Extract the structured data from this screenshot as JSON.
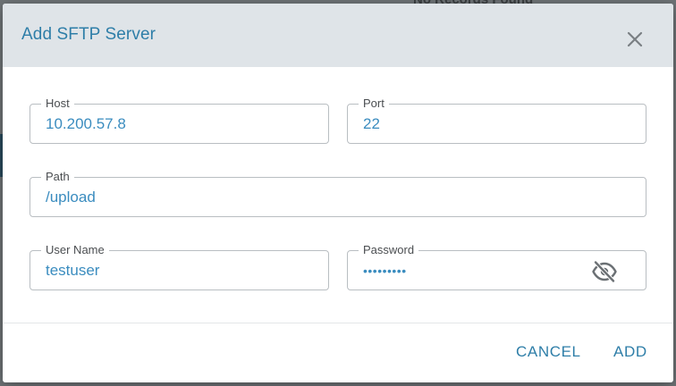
{
  "backdrop": {
    "partial_text": "No Records Found"
  },
  "dialog": {
    "title": "Add SFTP Server",
    "close_icon": "close-icon",
    "fields": {
      "host": {
        "label": "Host",
        "value": "10.200.57.8"
      },
      "port": {
        "label": "Port",
        "value": "22"
      },
      "path": {
        "label": "Path",
        "value": "/upload"
      },
      "username": {
        "label": "User Name",
        "value": "testuser"
      },
      "password": {
        "label": "Password",
        "value": "•••••••••",
        "toggle_icon": "eye-off-icon"
      }
    },
    "actions": {
      "cancel_label": "CANCEL",
      "add_label": "ADD"
    }
  },
  "colors": {
    "accent": "#2e7ea8",
    "value_text": "#3a8cbf",
    "header_bg": "#dfe4e8",
    "overlay": "#6f7477"
  }
}
